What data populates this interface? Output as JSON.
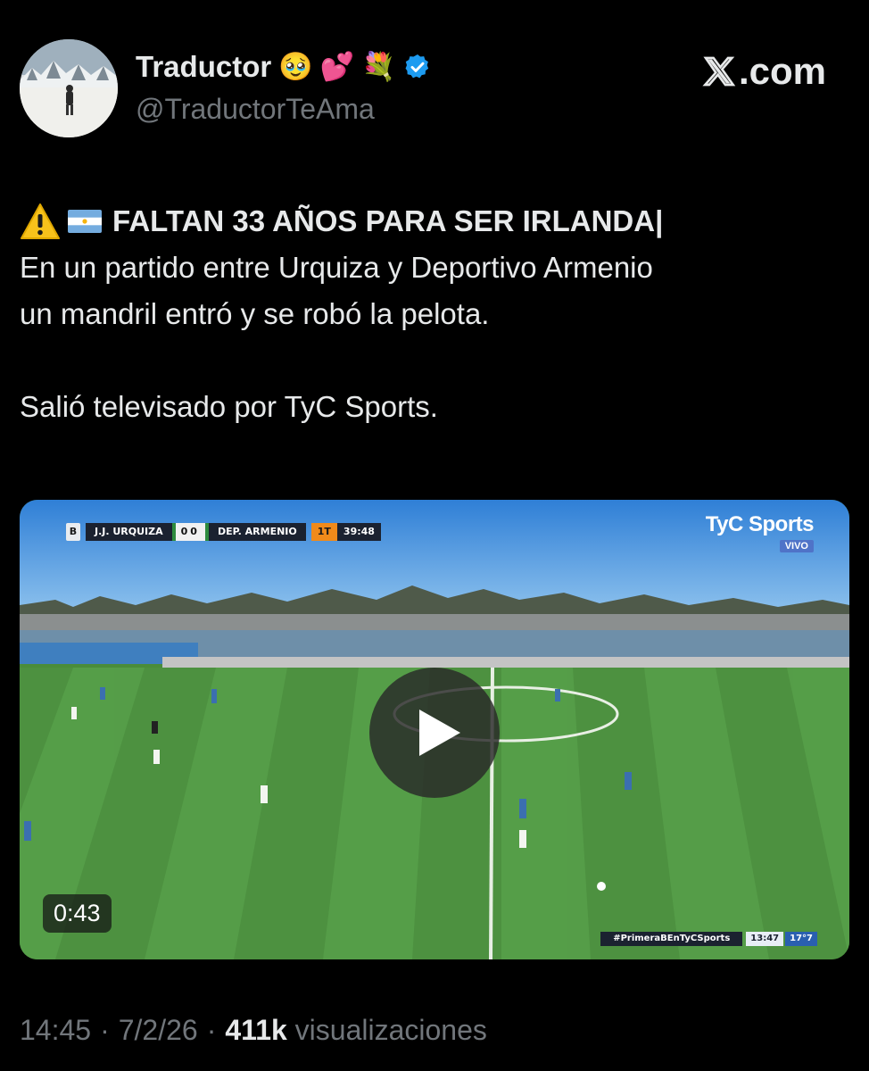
{
  "author": {
    "display_name": "Traductor",
    "name_emojis": [
      "🥹",
      "💕",
      "💐"
    ],
    "handle": "@TraductorTeAma",
    "verified": true,
    "avatar": "profile-photo-snow"
  },
  "site": {
    "label": ".com",
    "logo": "x-logo-icon"
  },
  "tweet": {
    "headline": "FALTAN 33 AÑOS PARA SER IRLANDA|",
    "headline_icons": [
      "warning-icon",
      "argentina-flag-icon"
    ],
    "body_line1": "En un partido entre Urquiza y Deportivo Armenio",
    "body_line2": "un mandril entró y se robó la pelota.",
    "body_line3": "Salió televisado por TyC Sports."
  },
  "video": {
    "duration": "0:43",
    "play_icon": "play-icon",
    "scorebug": {
      "logo": "B",
      "home_team": "J.J. URQUIZA",
      "home_score": "0",
      "away_score": "0",
      "away_team": "DEP. ARMENIO",
      "half": "1T",
      "clock": "39:48"
    },
    "broadcaster": "TyC Sports",
    "live_label": "VIVO",
    "ticker": {
      "hashtag": "#PrimeraBEnTyCSports",
      "time": "13:47",
      "temp": "17°7"
    }
  },
  "meta": {
    "time": "14:45",
    "separator": "·",
    "date": "7/2/26",
    "views_count": "411k",
    "views_label": "visualizaciones"
  },
  "colors": {
    "background": "#000000",
    "text": "#e7e9ea",
    "secondary_text": "#71767b",
    "verified_blue": "#1d9bf0",
    "pitch_green": "#4a8c3a"
  }
}
